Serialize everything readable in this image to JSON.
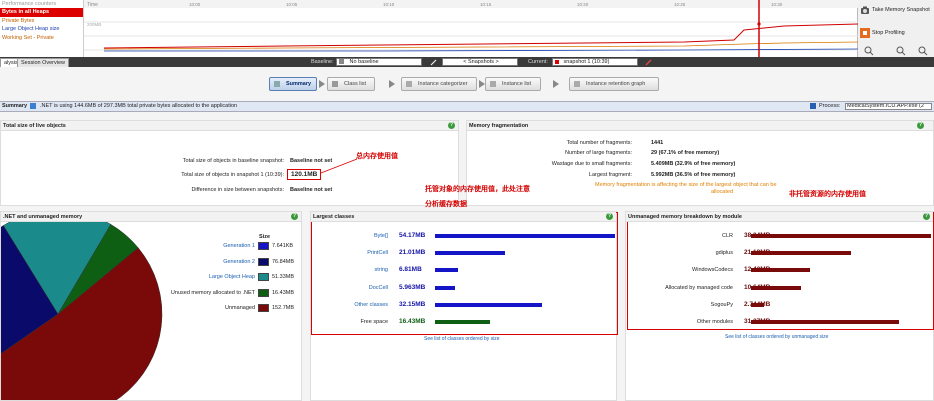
{
  "counters": {
    "title": "Performance counters",
    "items": [
      "Bytes in all Heaps",
      "Private Bytes",
      "Large Object Heap size",
      "Working Set - Private"
    ]
  },
  "timeline": {
    "time_label": "Time",
    "y_label": "200MB",
    "ticks": [
      "10:00",
      "10:05",
      "10:10",
      "10:15",
      "10:20",
      "10:25",
      "10:30",
      "10:35"
    ]
  },
  "actions": {
    "snapshot": "Take Memory Snapshot",
    "stop": "Stop Profiling"
  },
  "tabs": {
    "analysis": "alysis",
    "session": "Session Overview"
  },
  "toolbar": {
    "baseline_label": "Baseline:",
    "baseline_value": "No baseline",
    "snapshots": "< Snapshots >",
    "current_label": "Current:",
    "current_value": "snapshot 1 (10:39)"
  },
  "nav": {
    "summary": "Summary",
    "class_list": "Class list",
    "instance_categorizer": "Instance categorizer",
    "instance_list": "Instance list",
    "retention_graph": "Instance retention graph"
  },
  "summary_bar": {
    "title": "Summary",
    "text": ".NET is using 144.6MB of 297.3MB total private bytes allocated to the application",
    "process_label": "Process:",
    "process_value": "MedicalSystem.ICU.APP.exe (2"
  },
  "live": {
    "title": "Total size of live objects",
    "baseline_label": "Total size of objects in baseline snapshot:",
    "baseline_value": "Baseline not set",
    "snapshot_label": "Total size of objects in snapshot 1 (10:39):",
    "snapshot_value": "120.1MB",
    "diff_label": "Difference in size between snapshots:",
    "diff_value": "Baseline not set",
    "annotation": "总内存使用值"
  },
  "frag": {
    "title": "Memory fragmentation",
    "rows": [
      {
        "label": "Total number of fragments:",
        "value": "1441"
      },
      {
        "label": "Number of large fragments:",
        "value": "29 (67.1% of free memory)"
      },
      {
        "label": "Wastage due to small fragments:",
        "value": "5.409MB (32.9% of free memory)"
      },
      {
        "label": "Largest fragment:",
        "value": "5.992MB (36.5% of free memory)"
      }
    ],
    "warning_1": "Memory fragmentation is affecting the size of the largest object that can be",
    "warning_2": "allocated",
    "annotation": "非托管资源的内存使用值"
  },
  "dotnet": {
    "title": ".NET and unmanaged memory",
    "size_header": "Size",
    "legend": [
      {
        "label": "Generation 1",
        "value": "7.641KB",
        "color": "#1515c8",
        "link": true
      },
      {
        "label": "Generation 2",
        "value": "76.84MB",
        "color": "#0a0a6a",
        "link": true
      },
      {
        "label": "Large Object Heap",
        "value": "51.33MB",
        "color": "#1a8a8a",
        "link": true
      },
      {
        "label": "Unused memory allocated to .NET",
        "value": "16.43MB",
        "color": "#0e5e14",
        "link": false
      },
      {
        "label": "Unmanaged",
        "value": "152.7MB",
        "color": "#7a0a0a",
        "link": false
      }
    ]
  },
  "largest": {
    "title": "Largest classes",
    "annotation_1": "托管对象的内存使用值，此处注意",
    "annotation_2": "分析缓存数据",
    "rows": [
      {
        "label": "Byte[]",
        "value": "54.17MB",
        "mb": 54.17,
        "link": true
      },
      {
        "label": "PrintCell",
        "value": "21.01MB",
        "mb": 21.01,
        "link": true
      },
      {
        "label": "string",
        "value": "6.81MB",
        "mb": 6.81,
        "link": true
      },
      {
        "label": "DocCell",
        "value": "5.963MB",
        "mb": 5.963,
        "link": true
      },
      {
        "label": "Other classes",
        "value": "32.15MB",
        "mb": 32.15,
        "link": true
      },
      {
        "label": "Free space",
        "value": "16.43MB",
        "mb": 16.43,
        "link": false
      }
    ],
    "footer": "See list of classes ordered by size",
    "bar_color": "#1515c8",
    "free_color": "#0e5e14"
  },
  "unmanaged": {
    "title": "Unmanaged memory breakdown by module",
    "rows": [
      {
        "label": "CLR",
        "value": "38.04MB",
        "mb": 38.04
      },
      {
        "label": "gdiplus",
        "value": "21.19MB",
        "mb": 21.19
      },
      {
        "label": "WindowsCodecs",
        "value": "12.43MB",
        "mb": 12.43
      },
      {
        "label": "Allocated by managed code",
        "value": "10.64MB",
        "mb": 10.64
      },
      {
        "label": "SogouPy",
        "value": "2.744MB",
        "mb": 2.744
      },
      {
        "label": "Other modules",
        "value": "31.27MB",
        "mb": 31.27
      }
    ],
    "footer": "See list of classes ordered by unmanaged size",
    "bar_color": "#7a0a0a"
  }
}
